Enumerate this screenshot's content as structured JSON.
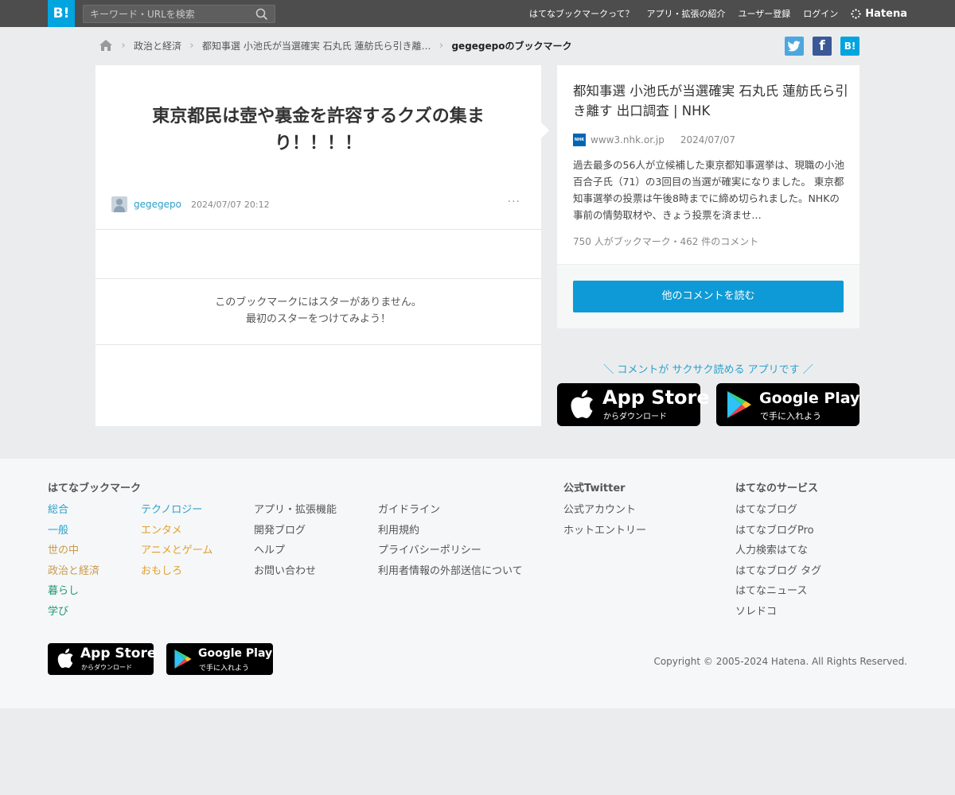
{
  "header": {
    "logo": "B!",
    "search_placeholder": "キーワード・URLを検索",
    "nav": [
      "はてなブックマークって？",
      "アプリ・拡張の紹介",
      "ユーザー登録",
      "ログイン"
    ],
    "brand": "Hatena"
  },
  "breadcrumb": {
    "items": [
      "政治と経済",
      "都知事選 小池氏が当選確実 石丸氏 蓮舫氏ら引き離…"
    ],
    "current": "gegegepoのブックマーク"
  },
  "share": {
    "twitter": "t",
    "facebook": "f",
    "hatena": "B!"
  },
  "bookmark": {
    "comment": "東京都民は壺や裏金を許容するクズの集まり！！！！",
    "user": "gegegepo",
    "datetime": "2024/07/07 20:12",
    "more": "···",
    "no_star_line1": "このブックマークにはスターがありません。",
    "no_star_line2": "最初のスターをつけてみよう！"
  },
  "entry": {
    "title": "都知事選 小池氏が当選確実 石丸氏 蓮舫氏ら引き離す 出口調査 | NHK",
    "favicon": "NHK",
    "domain": "www3.nhk.or.jp",
    "date": "2024/07/07",
    "description": "過去最多の56人が立候補した東京都知事選挙は、現職の小池百合子氏（71）の3回目の当選が確実になりました。 東京都知事選挙の投票は午後8時までに締め切られました。NHKの事前の情勢取材や、きょう投票を済ませ…",
    "count": "750 人がブックマーク・462 件のコメント",
    "read_button": "他のコメントを読む"
  },
  "app_promo": {
    "text": "＼ コメントが サクサク読める アプリです ／",
    "appstore_main": "App Store",
    "appstore_sub": "からダウンロード",
    "googleplay_main": "Google Play",
    "googleplay_sub": "で手に入れよう"
  },
  "footer": {
    "title_bookmark": "はてなブックマーク",
    "col1": [
      "総合",
      "一般",
      "世の中",
      "政治と経済",
      "暮らし",
      "学び"
    ],
    "col2": [
      "テクノロジー",
      "エンタメ",
      "アニメとゲーム",
      "おもしろ"
    ],
    "col3": [
      "アプリ・拡張機能",
      "開発ブログ",
      "ヘルプ",
      "お問い合わせ"
    ],
    "col4": [
      "ガイドライン",
      "利用規約",
      "プライバシーポリシー",
      "利用者情報の外部送信について"
    ],
    "title_twitter": "公式Twitter",
    "twitter_links": [
      "公式アカウント",
      "ホットエントリー"
    ],
    "title_services": "はてなのサービス",
    "services": [
      "はてなブログ",
      "はてなブログPro",
      "人力検索はてな",
      "はてなブログ タグ",
      "はてなニュース",
      "ソレドコ"
    ],
    "copyright": "Copyright © 2005-2024 Hatena. All Rights Reserved."
  },
  "colors": {
    "col1": [
      "#2aa1cc",
      "#2aa1cc",
      "#c99a4b",
      "#c99a4b",
      "#1e9a6e",
      "#1e9a6e"
    ],
    "col2": [
      "#2aa1cc",
      "#e0a030",
      "#e0a030",
      "#e0a030"
    ]
  }
}
